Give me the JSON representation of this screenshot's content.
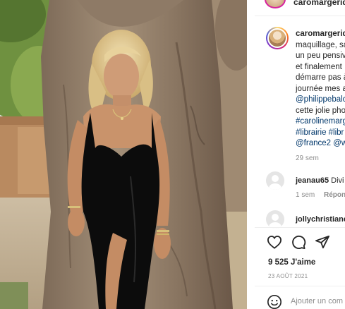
{
  "post": {
    "username": "caromargerid",
    "top_username": "caromargerid",
    "caption_lines": [
      "maquillage, sa",
      "un peu pensiv",
      "et finalement",
      "démarre pas à",
      "journée mes a"
    ],
    "mention_1": "@philippebalc",
    "caption_tail": "cette jolie pho",
    "hashtags_1": "#carolinemarg",
    "hashtags_2": "#librairie #libr",
    "mentions_2": "@france2 @w",
    "time": "29 sem",
    "likes": "9 525 J'aime",
    "date": "23 AOÛT 2021",
    "add_comment_placeholder": "Ajouter un com"
  },
  "comments": [
    {
      "user": "jeanau65",
      "text": "Divi",
      "time": "1 sem",
      "reply": "Répond"
    },
    {
      "user": "jollychristiane",
      "text": "",
      "time": "",
      "reply": ""
    }
  ],
  "icons": {
    "like": "heart-icon",
    "comment": "comment-icon",
    "share": "share-icon",
    "emoji": "emoji-icon"
  },
  "colors": {
    "link": "#00376b",
    "muted": "#8e8e8e",
    "text": "#262626"
  }
}
